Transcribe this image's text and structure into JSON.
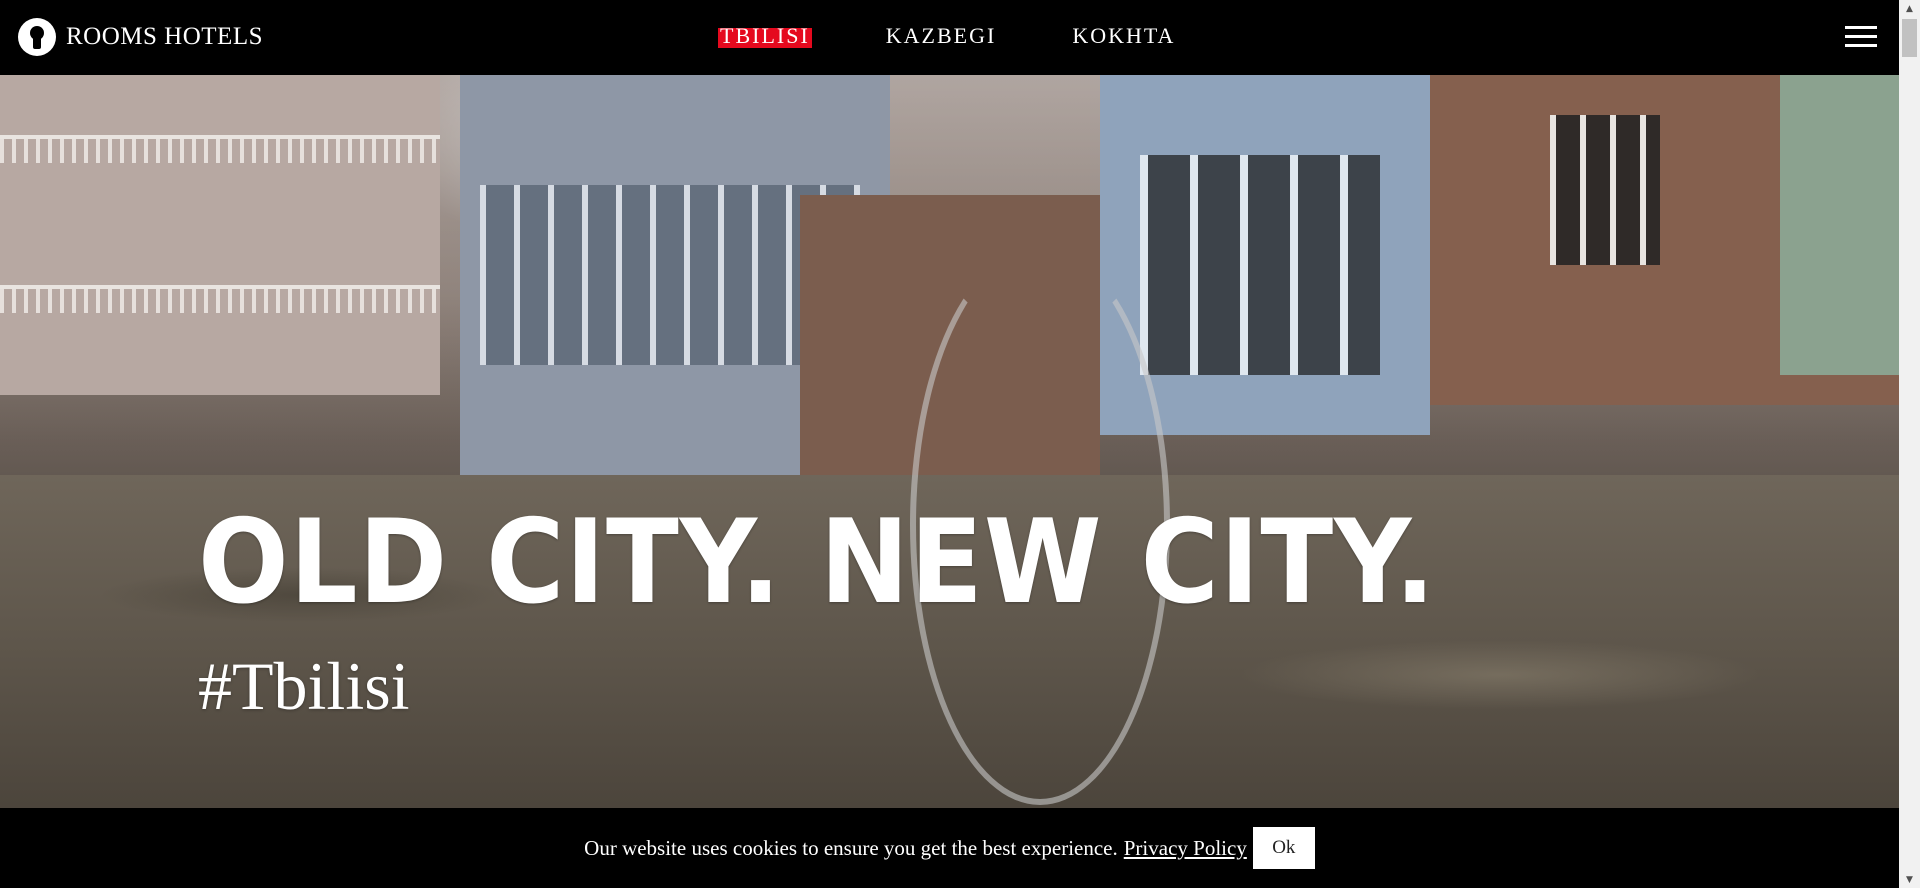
{
  "header": {
    "brand": "ROOMS HOTELS",
    "nav": [
      {
        "label": "TBILISI",
        "active": true
      },
      {
        "label": "KAZBEGI",
        "active": false
      },
      {
        "label": "KOKHTA",
        "active": false
      }
    ],
    "menu_icon": "hamburger-icon",
    "logo_icon": "keyhole-icon"
  },
  "hero": {
    "title": "OLD CITY. NEW CITY.",
    "tagline": "#Tbilisi"
  },
  "cookie": {
    "text": "Our website uses cookies to ensure you get the best experience.",
    "link_label": "Privacy Policy",
    "button_label": "Ok"
  },
  "scrollbar": {
    "up_icon": "▲",
    "down_icon": "▼"
  },
  "colors": {
    "accent": "#e5091e",
    "header_bg": "#000000",
    "text": "#ffffff"
  }
}
